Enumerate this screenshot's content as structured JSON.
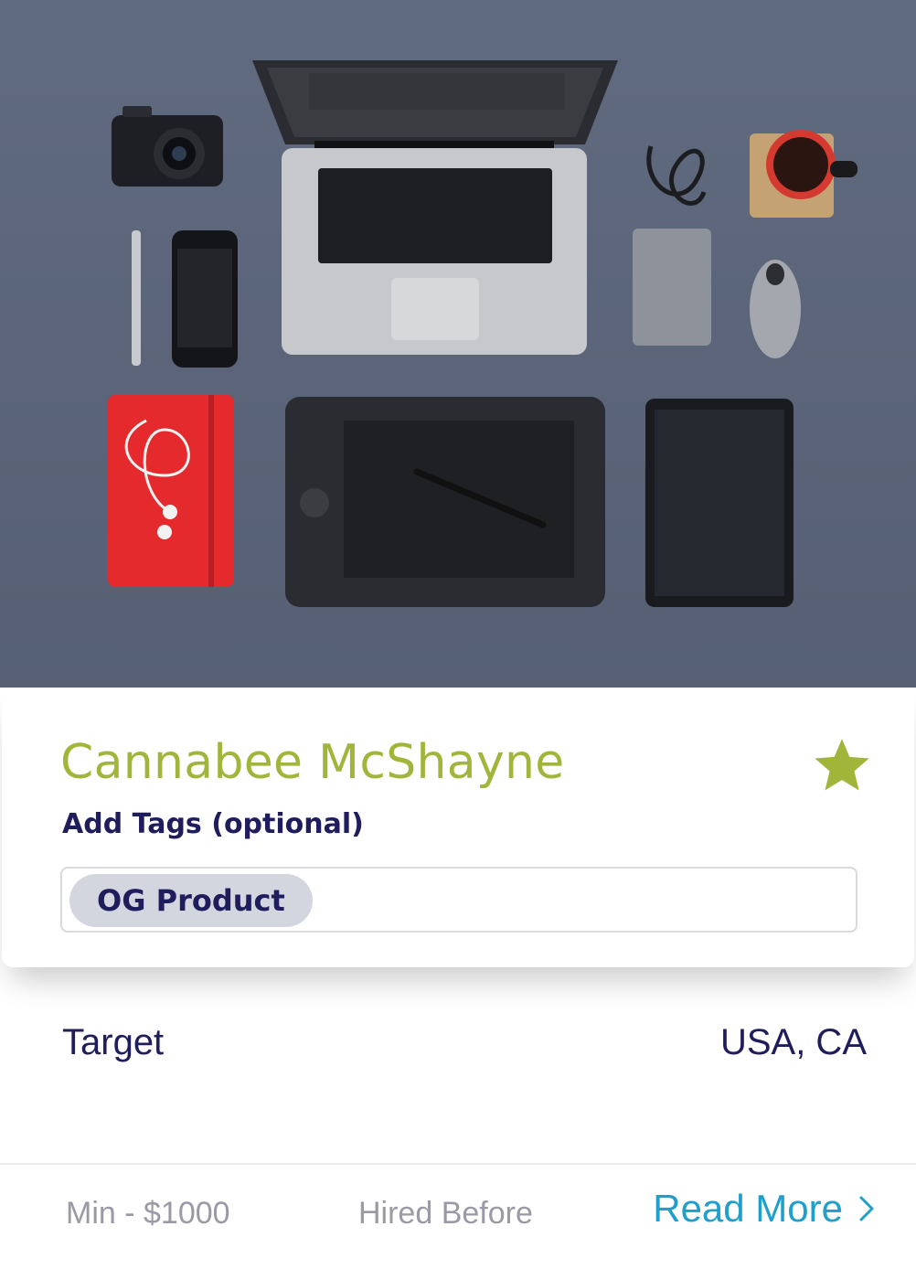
{
  "hero": {
    "image": "desk-flatlay-photo"
  },
  "card": {
    "name": "Cannabee McShayne",
    "favorite_icon": "star-icon",
    "tags_label": "Add Tags (optional)",
    "tags": [
      "OG Product"
    ],
    "accent_color": "#a1b53a"
  },
  "details": {
    "target_label": "Target",
    "target_value": "USA, CA"
  },
  "footer": {
    "min": "Min - $1000",
    "hired": "Hired Before",
    "read_more": "Read More",
    "read_more_icon": "chevron-right-icon",
    "link_color": "#1e9fcc"
  }
}
